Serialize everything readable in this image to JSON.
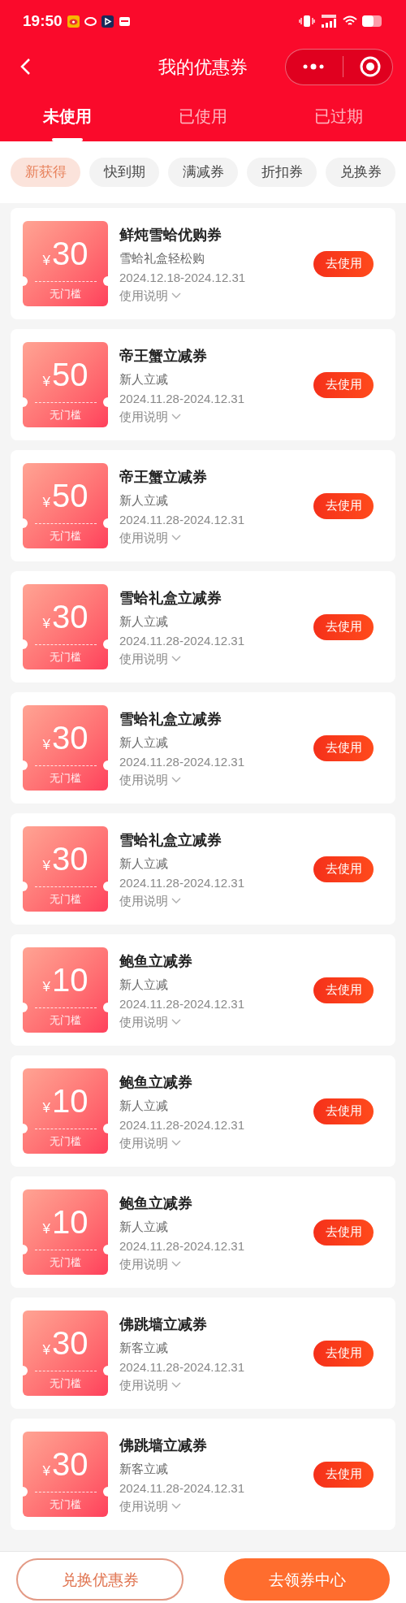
{
  "status_bar": {
    "time": "19:50"
  },
  "header": {
    "title": "我的优惠券"
  },
  "tabs": [
    {
      "label": "未使用",
      "selected": true
    },
    {
      "label": "已使用",
      "selected": false
    },
    {
      "label": "已过期",
      "selected": false
    }
  ],
  "filters": [
    {
      "label": "新获得",
      "selected": true
    },
    {
      "label": "快到期",
      "selected": false
    },
    {
      "label": "满减券",
      "selected": false
    },
    {
      "label": "折扣券",
      "selected": false
    },
    {
      "label": "兑换券",
      "selected": false
    }
  ],
  "coupons": [
    {
      "currency": "¥",
      "amount": "30",
      "threshold": "无门槛",
      "title": "鲜炖雪蛤优购券",
      "subtitle": "雪蛤礼盒轻松购",
      "validity": "2024.12.18-2024.12.31",
      "details": "使用说明",
      "action": "去使用"
    },
    {
      "currency": "¥",
      "amount": "50",
      "threshold": "无门槛",
      "title": "帝王蟹立减券",
      "subtitle": "新人立减",
      "validity": "2024.11.28-2024.12.31",
      "details": "使用说明",
      "action": "去使用"
    },
    {
      "currency": "¥",
      "amount": "50",
      "threshold": "无门槛",
      "title": "帝王蟹立减券",
      "subtitle": "新人立减",
      "validity": "2024.11.28-2024.12.31",
      "details": "使用说明",
      "action": "去使用"
    },
    {
      "currency": "¥",
      "amount": "30",
      "threshold": "无门槛",
      "title": "雪蛤礼盒立减券",
      "subtitle": "新人立减",
      "validity": "2024.11.28-2024.12.31",
      "details": "使用说明",
      "action": "去使用"
    },
    {
      "currency": "¥",
      "amount": "30",
      "threshold": "无门槛",
      "title": "雪蛤礼盒立减券",
      "subtitle": "新人立减",
      "validity": "2024.11.28-2024.12.31",
      "details": "使用说明",
      "action": "去使用"
    },
    {
      "currency": "¥",
      "amount": "30",
      "threshold": "无门槛",
      "title": "雪蛤礼盒立减券",
      "subtitle": "新人立减",
      "validity": "2024.11.28-2024.12.31",
      "details": "使用说明",
      "action": "去使用"
    },
    {
      "currency": "¥",
      "amount": "10",
      "threshold": "无门槛",
      "title": "鲍鱼立减券",
      "subtitle": "新人立减",
      "validity": "2024.11.28-2024.12.31",
      "details": "使用说明",
      "action": "去使用"
    },
    {
      "currency": "¥",
      "amount": "10",
      "threshold": "无门槛",
      "title": "鲍鱼立减券",
      "subtitle": "新人立减",
      "validity": "2024.11.28-2024.12.31",
      "details": "使用说明",
      "action": "去使用"
    },
    {
      "currency": "¥",
      "amount": "10",
      "threshold": "无门槛",
      "title": "鲍鱼立减券",
      "subtitle": "新人立减",
      "validity": "2024.11.28-2024.12.31",
      "details": "使用说明",
      "action": "去使用"
    },
    {
      "currency": "¥",
      "amount": "30",
      "threshold": "无门槛",
      "title": "佛跳墙立减券",
      "subtitle": "新客立减",
      "validity": "2024.11.28-2024.12.31",
      "details": "使用说明",
      "action": "去使用"
    },
    {
      "currency": "¥",
      "amount": "30",
      "threshold": "无门槛",
      "title": "佛跳墙立减券",
      "subtitle": "新客立减",
      "validity": "2024.11.28-2024.12.31",
      "details": "使用说明",
      "action": "去使用"
    }
  ],
  "bottom_bar": {
    "secondary_button": "兑换优惠券",
    "primary_button": "去领券中心"
  }
}
